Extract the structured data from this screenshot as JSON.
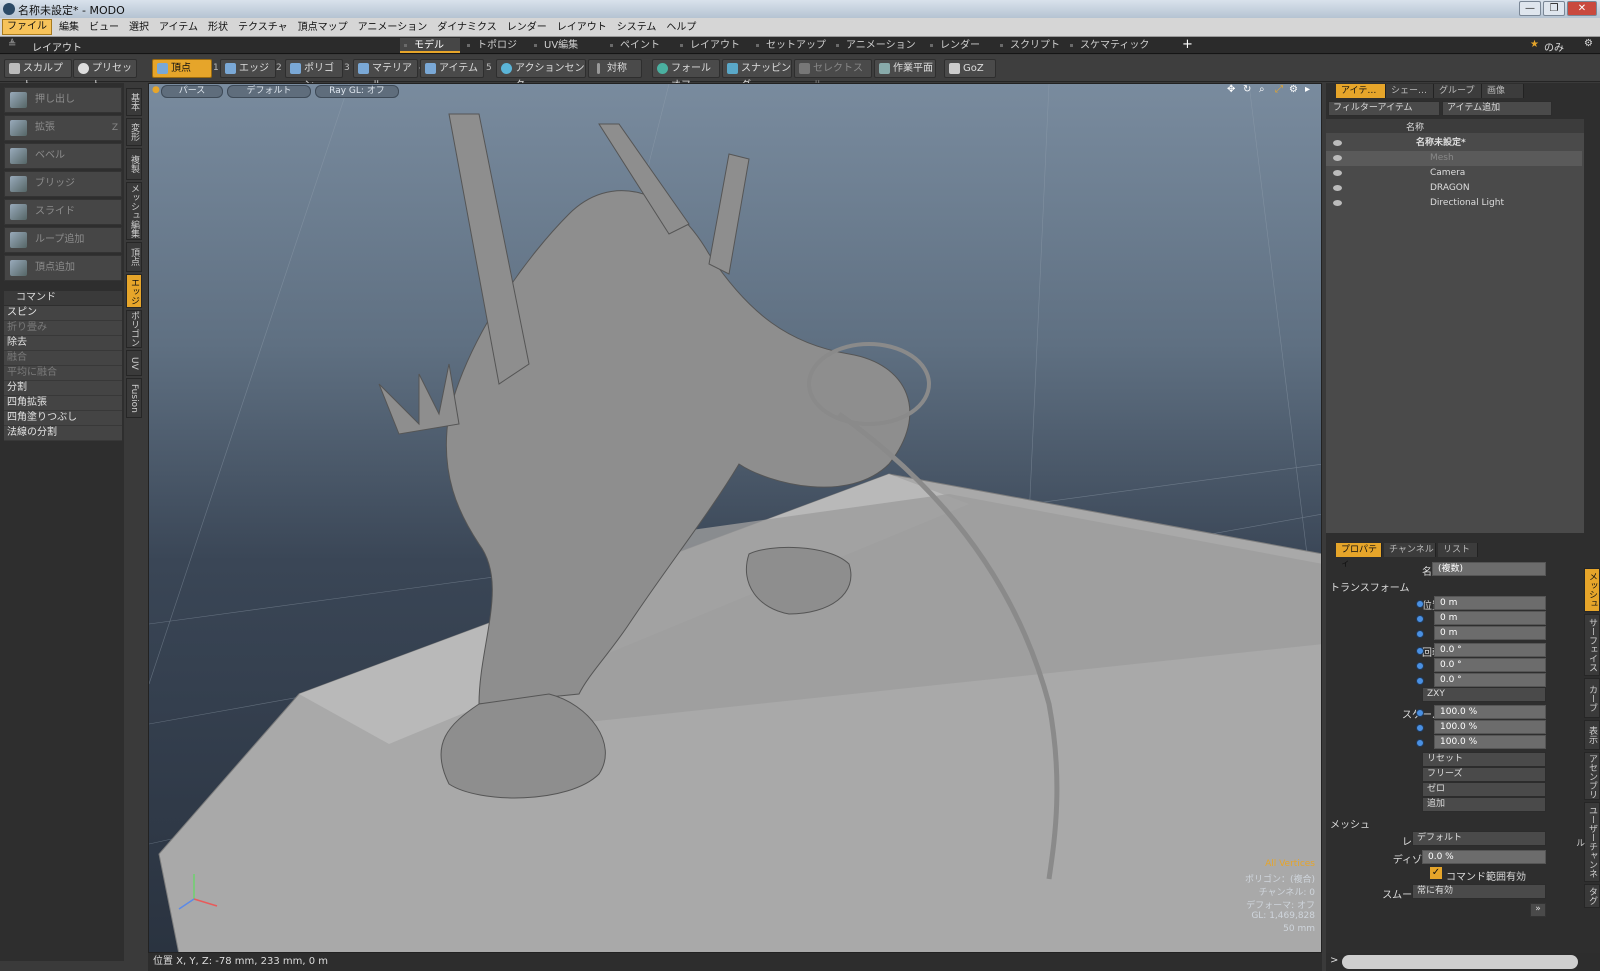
{
  "window": {
    "title": "名称未設定* - MODO",
    "min": "—",
    "max": "❐",
    "close": "✕"
  },
  "menu": [
    "ファイル",
    "編集",
    "ビュー",
    "選択",
    "アイテム",
    "形状",
    "テクスチャ",
    "頂点マップ",
    "アニメーション",
    "ダイナミクス",
    "レンダー",
    "レイアウト",
    "システム",
    "ヘルプ"
  ],
  "tabbar": {
    "layout_label": "レイアウト",
    "tabs": [
      "モデル",
      "トポロジ",
      "UV編集",
      "ペイント",
      "レイアウト",
      "セットアップ",
      "アニメーション",
      "レンダー",
      "スクリプト",
      "スケマティックFusion"
    ],
    "add": "+",
    "only": "のみ"
  },
  "toolbar": {
    "sculpt": "スカルプト",
    "preset": "プリセット",
    "vertex": "頂点",
    "vnum": "1",
    "edge": "エッジ",
    "enum": "2",
    "polygon": "ポリゴン",
    "pnum": "3",
    "material": "マテリアル",
    "mnum": "4",
    "item": "アイテム",
    "inum": "5",
    "action_center": "アクションセンター",
    "symmetry": "対称",
    "falloff": "フォールオフ",
    "snapping": "スナッピング",
    "select_through": "セレクトスルー",
    "workplane": "作業平面",
    "goz": "GoZ"
  },
  "left": {
    "tools": [
      {
        "label": "押し出し",
        "key": ""
      },
      {
        "label": "拡張",
        "key": "Z"
      },
      {
        "label": "ベベル",
        "key": ""
      },
      {
        "label": "ブリッジ",
        "key": ""
      },
      {
        "label": "スライド",
        "key": ""
      },
      {
        "label": "ループ追加",
        "key": ""
      },
      {
        "label": "頂点追加",
        "key": ""
      }
    ],
    "cmd_header": "コマンド",
    "commands": [
      {
        "label": "スピン",
        "dim": false
      },
      {
        "label": "折り畳み",
        "dim": true
      },
      {
        "label": "除去",
        "dim": false
      },
      {
        "label": "融合",
        "dim": true
      },
      {
        "label": "平均に融合",
        "dim": true
      },
      {
        "label": "分割",
        "dim": false
      },
      {
        "label": "四角拡張",
        "dim": false
      },
      {
        "label": "四角塗りつぶし",
        "dim": false
      },
      {
        "label": "法線の分割",
        "dim": false
      }
    ],
    "vtabs": [
      "基本",
      "変形",
      "複製",
      "メッシュ編集",
      "頂点",
      "エッジ",
      "ポリゴン",
      "UV",
      "Fusion"
    ]
  },
  "viewport": {
    "perspective": "パース",
    "default": "デフォルト",
    "raygl": "Ray GL: オフ",
    "info": {
      "all_vertices": "All Vertices",
      "polygons": "ポリゴン：(複合)",
      "channels": "チャンネル: 0",
      "deformer": "デフォーマ: オフ",
      "count": "GL: 1,469,828",
      "scale": "50 mm"
    }
  },
  "status": {
    "text": "位置 X, Y, Z:  -78 mm, 233 mm, 0 m"
  },
  "right": {
    "tabs": [
      "アイテ…",
      "シェー…",
      "グループ",
      "画像"
    ],
    "filter": "フィルターアイテム",
    "add_item": "アイテム追加",
    "name_header": "名称",
    "tree": [
      {
        "label": "名称未設定*",
        "indent": 0
      },
      {
        "label": "Mesh",
        "indent": 1
      },
      {
        "label": "Camera",
        "indent": 1
      },
      {
        "label": "DRAGON",
        "indent": 1
      },
      {
        "label": "Directional Light",
        "indent": 1
      }
    ],
    "ptabs": [
      "プロパティ",
      "チャンネル",
      "リスト"
    ],
    "props": {
      "name_label": "名称",
      "name_value": "(複数)",
      "transform": "トランスフォーム",
      "pos_label": "位置",
      "rot_label": "回転",
      "scale_label": "スケール",
      "order_label": "順序",
      "px": "0 m",
      "py": "0 m",
      "pz": "0 m",
      "rx": "0.0 °",
      "ry": "0.0 °",
      "rz": "0.0 °",
      "order": "ZXY",
      "sx": "100.0 %",
      "sy": "100.0 %",
      "sz": "100.0 %",
      "reset": "リセット",
      "freeze": "フリーズ",
      "zero": "ゼロ",
      "add": "追加",
      "mesh": "メッシュ",
      "render_label": "レンダー",
      "render": "デフォルト",
      "dissolve_label": "ディゾルブ",
      "dissolve": "0.0 %",
      "cmd_region": "コマンド範囲有効",
      "smooth_label": "スムージング",
      "smooth": "常に有効"
    },
    "rvtabs": [
      "メッシュ",
      "サーフェイス",
      "カーブ",
      "表示",
      "アセンブリ",
      "ユーザーチャンネル",
      "タグ"
    ]
  }
}
